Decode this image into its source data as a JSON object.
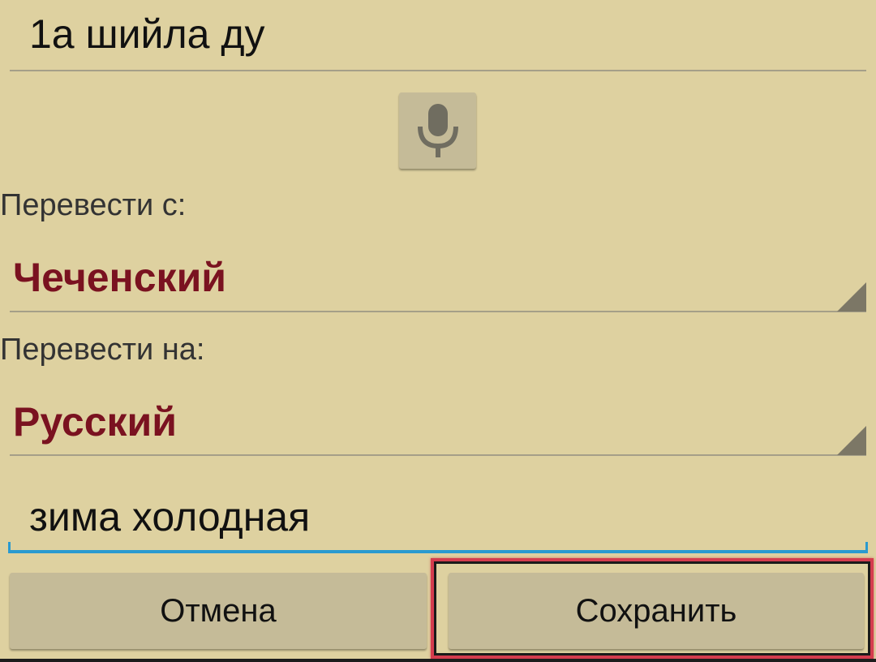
{
  "source_field": {
    "value": "1а шийла ду"
  },
  "mic_button": {
    "icon": "microphone-icon"
  },
  "translate_from": {
    "label": "Перевести с:",
    "selected": "Чеченский"
  },
  "translate_to": {
    "label": "Перевести на:",
    "selected": "Русский"
  },
  "target_field": {
    "value": "зима холодная"
  },
  "buttons": {
    "cancel_label": "Отмена",
    "save_label": "Сохранить"
  },
  "colors": {
    "background": "#ded1a0",
    "button": "#c5bb98",
    "spinner_text": "#7a1220",
    "focus_accent": "#2a9ad0",
    "highlight": "#d43c4e"
  }
}
